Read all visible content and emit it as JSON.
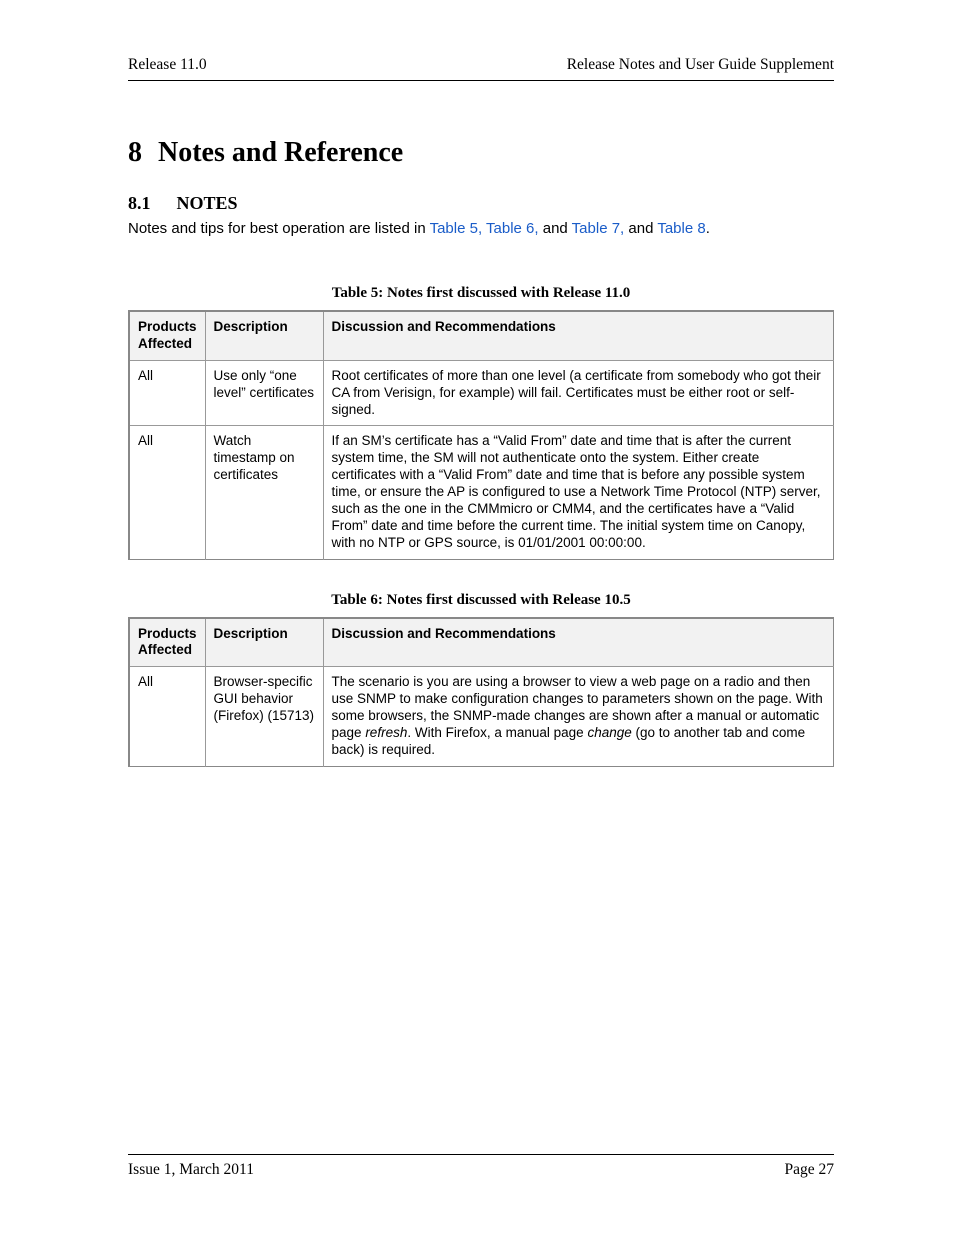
{
  "header": {
    "left": "Release 11.0",
    "right": "Release Notes and User Guide Supplement"
  },
  "section": {
    "number": "8",
    "title": "Notes and Reference"
  },
  "subsection": {
    "number": "8.1",
    "title": "NOTES",
    "intro_pre": "Notes and tips for best operation are listed in ",
    "link1": "Table 5,",
    "sep1": " ",
    "link2": "Table 6,",
    "sep2": " and ",
    "link3": "Table 7,",
    "sep3": " and ",
    "link4": "Table 8",
    "post": "."
  },
  "table5": {
    "caption": "Table 5: Notes first discussed with Release 11.0",
    "headers": {
      "products": "Products Affected",
      "description": "Description",
      "discussion": "Discussion and Recommendations"
    },
    "rows": [
      {
        "products": "All",
        "description": "Use only “one level” certificates",
        "discussion": "Root certificates of more than one level (a certificate from somebody who got their CA from Verisign, for example) will fail. Certificates must be either root or self-signed."
      },
      {
        "products": "All",
        "description": "Watch timestamp on certificates",
        "discussion": "If an SM’s certificate has a “Valid From” date and time that is after the current system time, the SM will not authenticate onto the system. Either create certificates with a “Valid From” date and time that is before any possible system time, or ensure the AP is configured to use a Network Time Protocol (NTP) server, such as the one in the CMMmicro or CMM4, and the certificates have a “Valid From” date and time before the current time. The initial system time on Canopy, with no NTP or GPS source, is 01/01/2001 00:00:00."
      }
    ]
  },
  "table6": {
    "caption": "Table 6: Notes first discussed with Release 10.5",
    "headers": {
      "products": "Products Affected",
      "description": "Description",
      "discussion": "Discussion and Recommendations"
    },
    "rows": [
      {
        "products": "All",
        "description": "Browser-specific GUI behavior (Firefox) (15713)",
        "discussion_pre": "The scenario is you are using a browser to view a web page on a radio and then use SNMP to make configuration changes to parameters shown on the page. With some browsers, the SNMP-made changes are shown after a manual or automatic page ",
        "discussion_italic1": "refresh",
        "discussion_mid": ". With Firefox, a manual page ",
        "discussion_italic2": "change",
        "discussion_post": " (go to another tab and come back) is required."
      }
    ]
  },
  "footer": {
    "left": "Issue 1, March 2011",
    "right": "Page 27"
  }
}
